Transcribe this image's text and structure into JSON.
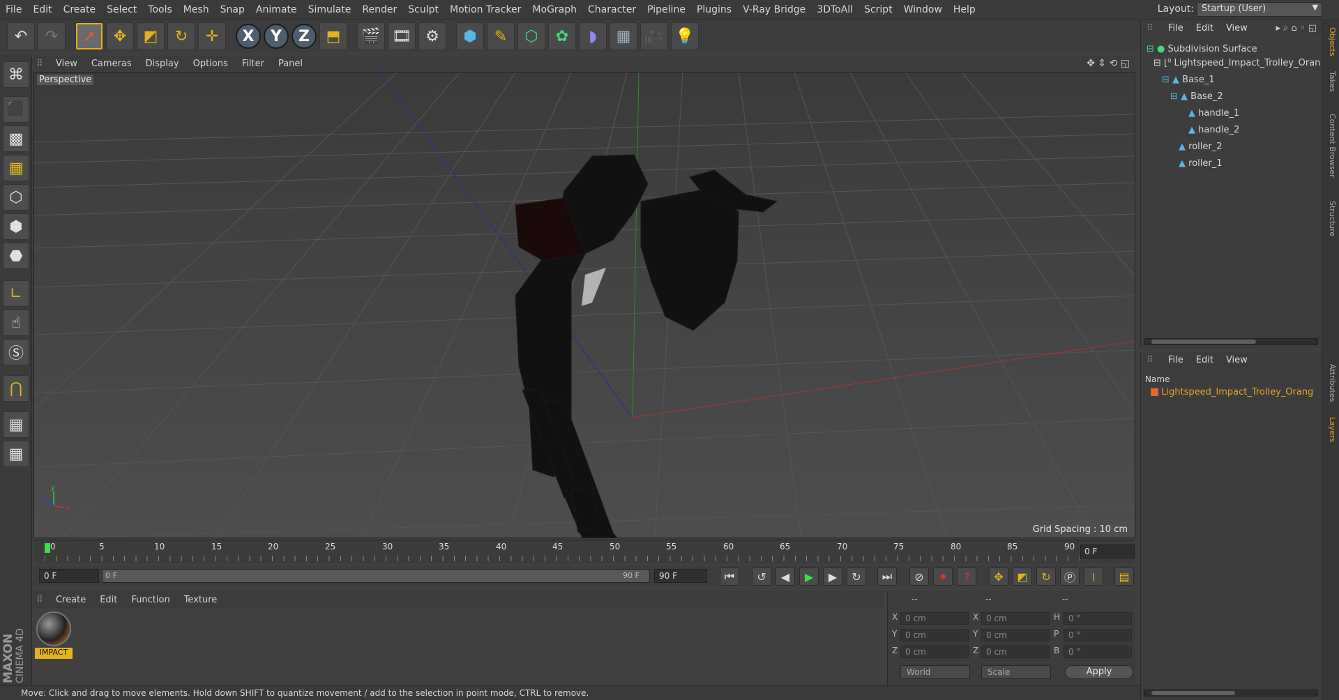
{
  "menu": [
    "File",
    "Edit",
    "Create",
    "Select",
    "Tools",
    "Mesh",
    "Snap",
    "Animate",
    "Simulate",
    "Render",
    "Sculpt",
    "Motion Tracker",
    "MoGraph",
    "Character",
    "Pipeline",
    "Plugins",
    "V-Ray Bridge",
    "3DToAll",
    "Script",
    "Window",
    "Help"
  ],
  "layout": {
    "label": "Layout:",
    "value": "Startup (User)"
  },
  "viewport": {
    "menu": [
      "View",
      "Cameras",
      "Display",
      "Options",
      "Filter",
      "Panel"
    ],
    "camera": "Perspective",
    "grid_spacing": "Grid Spacing : 10 cm"
  },
  "timeline": {
    "ticks": [
      "0",
      "5",
      "10",
      "15",
      "20",
      "25",
      "30",
      "35",
      "40",
      "45",
      "50",
      "55",
      "60",
      "65",
      "70",
      "75",
      "80",
      "85",
      "90"
    ],
    "current_frame": "0 F"
  },
  "transport": {
    "start": "0 F",
    "slider_left": "0 F",
    "slider_right": "90 F",
    "end": "90 F"
  },
  "material_panel": {
    "menu": [
      "Create",
      "Edit",
      "Function",
      "Texture"
    ],
    "material_name": "IMPACT"
  },
  "coords": {
    "headers": [
      "--",
      "--",
      "--"
    ],
    "rows": [
      {
        "a": "X",
        "av": "0 cm",
        "b": "X",
        "bv": "0 cm",
        "c": "H",
        "cv": "0 °"
      },
      {
        "a": "Y",
        "av": "0 cm",
        "b": "Y",
        "bv": "0 cm",
        "c": "P",
        "cv": "0 °"
      },
      {
        "a": "Z",
        "av": "0 cm",
        "b": "Z",
        "bv": "0 cm",
        "c": "B",
        "cv": "0 °"
      }
    ],
    "space": "World",
    "mode": "Scale",
    "apply": "Apply"
  },
  "status": "Move: Click and drag to move elements. Hold down SHIFT to quantize movement / add to the selection in point mode, CTRL to remove.",
  "objects": {
    "menu": [
      "File",
      "Edit",
      "View"
    ],
    "tree": [
      "Subdivision Surface",
      "Lightspeed_Impact_Trolley_Oran",
      "Base_1",
      "Base_2",
      "handle_1",
      "handle_2",
      "roller_2",
      "roller_1"
    ]
  },
  "layers": {
    "menu": [
      "File",
      "Edit",
      "View"
    ],
    "header": "Name",
    "item": "Lightspeed_Impact_Trolley_Orang"
  },
  "side_tabs": [
    "Objects",
    "Takes",
    "Content Browser",
    "Structure",
    "Attributes",
    "Layers"
  ],
  "brand": {
    "line1": "MAXON",
    "line2": "CINEMA 4D"
  },
  "colors": {
    "accent": "#e4b21b",
    "object_icon": "#5ab4e8",
    "layer_swatch": "#e06a2a"
  }
}
